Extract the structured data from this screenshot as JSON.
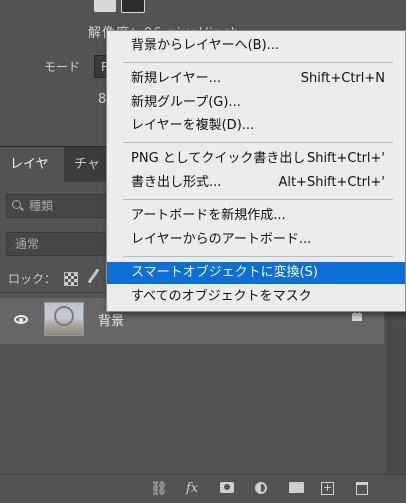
{
  "properties": {
    "resolution_label": "解像度：96 pixel/inch",
    "mode_label": "モード",
    "mode_value": "R",
    "depth_value": "8"
  },
  "layers_panel": {
    "tabs": [
      {
        "label": "レイヤー"
      },
      {
        "label": "チャン"
      }
    ],
    "filter_placeholder": "種類",
    "blend_mode": "通常",
    "lock_label": "ロック：",
    "layers": [
      {
        "name": "背景",
        "visible": true,
        "locked": true
      }
    ]
  },
  "bottom_toolbar": {
    "fx_label": "fx",
    "link_glyph": "⛓",
    "new_glyph": "+"
  },
  "context_menu": {
    "items": [
      {
        "label": "背景からレイヤーへ(B)...",
        "shortcut": ""
      },
      {
        "label": "新規レイヤー...",
        "shortcut": "Shift+Ctrl+N"
      },
      {
        "label": "新規グループ(G)...",
        "shortcut": ""
      },
      {
        "label": "レイヤーを複製(D)...",
        "shortcut": ""
      },
      {
        "label": "PNG としてクイック書き出し",
        "shortcut": "Shift+Ctrl+'"
      },
      {
        "label": "書き出し形式...",
        "shortcut": "Alt+Shift+Ctrl+'"
      },
      {
        "label": "アートボードを新規作成...",
        "shortcut": ""
      },
      {
        "label": "レイヤーからのアートボード...",
        "shortcut": ""
      },
      {
        "label": "スマートオブジェクトに変換(S)",
        "shortcut": "",
        "highlighted": true
      },
      {
        "label": "すべてのオブジェクトをマスク",
        "shortcut": ""
      }
    ],
    "highlight_color": "#0a6fd8"
  }
}
